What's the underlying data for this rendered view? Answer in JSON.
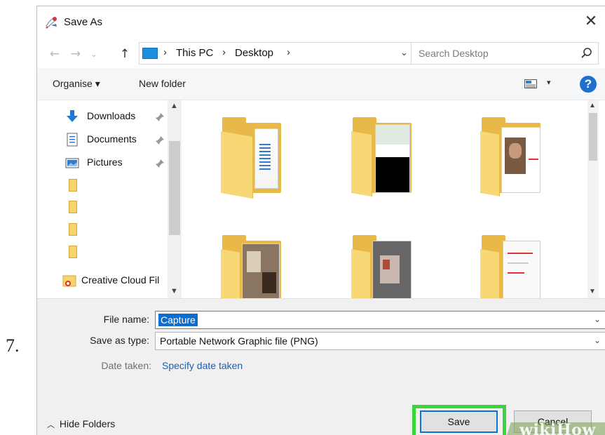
{
  "step": {
    "number": "7."
  },
  "dialog": {
    "title": "Save As",
    "close_glyph": "✕",
    "nav": {
      "back": "←",
      "forward": "→",
      "recent": "⌄",
      "up": "↑"
    },
    "breadcrumb": {
      "sep": "›",
      "items": [
        "This PC",
        "Desktop"
      ]
    },
    "address_dropdown": "⌄",
    "refresh_glyph": "↻",
    "search": {
      "placeholder": "Search Desktop"
    },
    "toolbar": {
      "organise": "Organise ▾",
      "new_folder": "New folder",
      "view_drop": "▾",
      "help": "?"
    },
    "sidebar": {
      "items": [
        {
          "label": "Downloads",
          "icon": "downloads-icon"
        },
        {
          "label": "Documents",
          "icon": "documents-icon"
        },
        {
          "label": "Pictures",
          "icon": "pictures-icon"
        }
      ],
      "creative_cloud": "Creative Cloud Fil",
      "scroll_up": "▲",
      "scroll_down": "▼"
    },
    "content": {
      "scroll_up": "▲",
      "scroll_down": "▼"
    },
    "form": {
      "file_name_label": "File name:",
      "file_name_value": "Capture",
      "save_type_label": "Save as type:",
      "save_type_value": "Portable Network Graphic file (PNG)",
      "date_taken_label": "Date taken:",
      "date_taken_link": "Specify date taken",
      "dropdown": "⌄"
    },
    "footer": {
      "hide_folders_chevron": "︿",
      "hide_folders": "Hide Folders",
      "save": "Save",
      "cancel": "Cancel"
    }
  },
  "watermark": "wikiHow",
  "colors": {
    "highlight": "#37d63b",
    "accent": "#0a74d4",
    "folder": "#f8d775",
    "help": "#1f6fd1"
  }
}
